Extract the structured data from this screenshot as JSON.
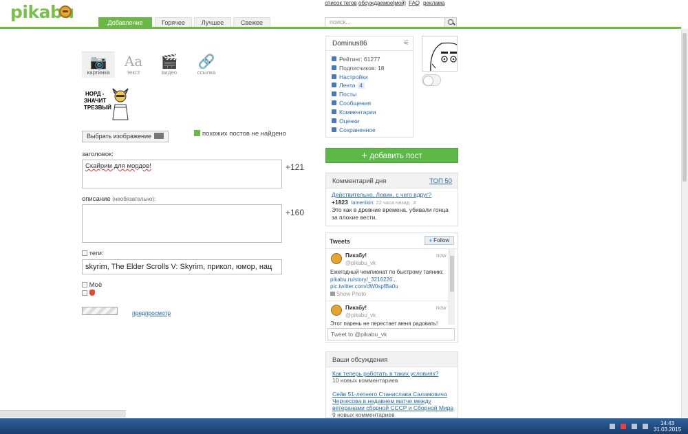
{
  "header": {
    "logo": "pikabu",
    "nav_tabs": [
      "Добавление поста",
      "Горячее",
      "Лучшее",
      "Свежее"
    ],
    "top_links": [
      "список тегов",
      "обсуждаемое",
      "[мой]",
      "FAQ",
      "реклама"
    ],
    "search_placeholder": "поиск..."
  },
  "post_types": [
    {
      "label": "картинка",
      "glyph": "📷"
    },
    {
      "label": "текст",
      "glyph": "Aa"
    },
    {
      "label": "видео",
      "glyph": "🎬"
    },
    {
      "label": "ссылка",
      "glyph": "🔗"
    }
  ],
  "image": {
    "line1": "НОРД -",
    "line2": "ЗНАЧИТ",
    "line3": "ТРЕЗВЫЙ"
  },
  "form": {
    "choose_image": "Выбрать изображение",
    "no_similar": "похожих постов не найдено",
    "title_label": "заголовок:",
    "title_value": "Скайрим для мордов!",
    "title_counter": "+121",
    "desc_label": "описание",
    "desc_hint": "(необязательно):",
    "desc_counter": "+160",
    "tags_label": "теги:",
    "tags_value": "skyrim, The Elder Scrolls V: Skyrim, прикол, юмор, нац",
    "mine_label": "Моё",
    "preview": "предпросмотр"
  },
  "user": {
    "name": "Dominus86",
    "items": [
      {
        "label": "Рейтинг: 61277",
        "link": false
      },
      {
        "label": "Подписчиков: 18",
        "link": false
      },
      {
        "label": "Настройки",
        "link": true
      },
      {
        "label": "Лента",
        "link": true,
        "badge": "4"
      },
      {
        "label": "Посты",
        "link": true
      },
      {
        "label": "Сообщения",
        "link": true
      },
      {
        "label": "Комментарии",
        "link": true
      },
      {
        "label": "Оценки",
        "link": true
      },
      {
        "label": "Сохраненное",
        "link": true
      }
    ]
  },
  "add_post": "добавить пост",
  "comment_day": {
    "title": "Комментарий дня",
    "top": "ТОП 50",
    "link": "Действительно, Левин, с чего вдруг?",
    "score": "+1823",
    "author": "lamerlikin",
    "time": "; 22 часа назад",
    "hash": "#",
    "text1": "Это как в древние времена, убивали гонца",
    "text2": "за плохие вести."
  },
  "tweets": {
    "title": "Tweets",
    "follow": "Follow",
    "items": [
      {
        "name": "Пикабу!",
        "handle": "@pikabu_vk",
        "time": "now",
        "text": "Ежегодный чемпионат по быстрому таянию:",
        "link1": "pikabu.ru/story/_3216226...",
        "link2": "pic.twitter.com/dW0spfBa0u",
        "photo": "Show Photo"
      },
      {
        "name": "Пикабу!",
        "handle": "@pikabu_vk",
        "time": "now",
        "text": "Этот парень не перестает меня радовать!"
      }
    ],
    "input_placeholder": "Tweet to @pikabu_vk"
  },
  "discussions": {
    "title": "Ваши обсуждения",
    "items": [
      {
        "lines": [
          "Как теперь работать в таких условиях?"
        ],
        "count": "10 новых комментариев"
      },
      {
        "lines": [
          "Сейв 51-летнего Станислава Саламовича",
          "Черчесова в недавнем матче между",
          "ветеранами сборной СССР и Сборной Мира"
        ],
        "count": "9 новых комментариев"
      }
    ]
  },
  "taskbar": {
    "time": "14:43",
    "date": "31.03.2015"
  }
}
